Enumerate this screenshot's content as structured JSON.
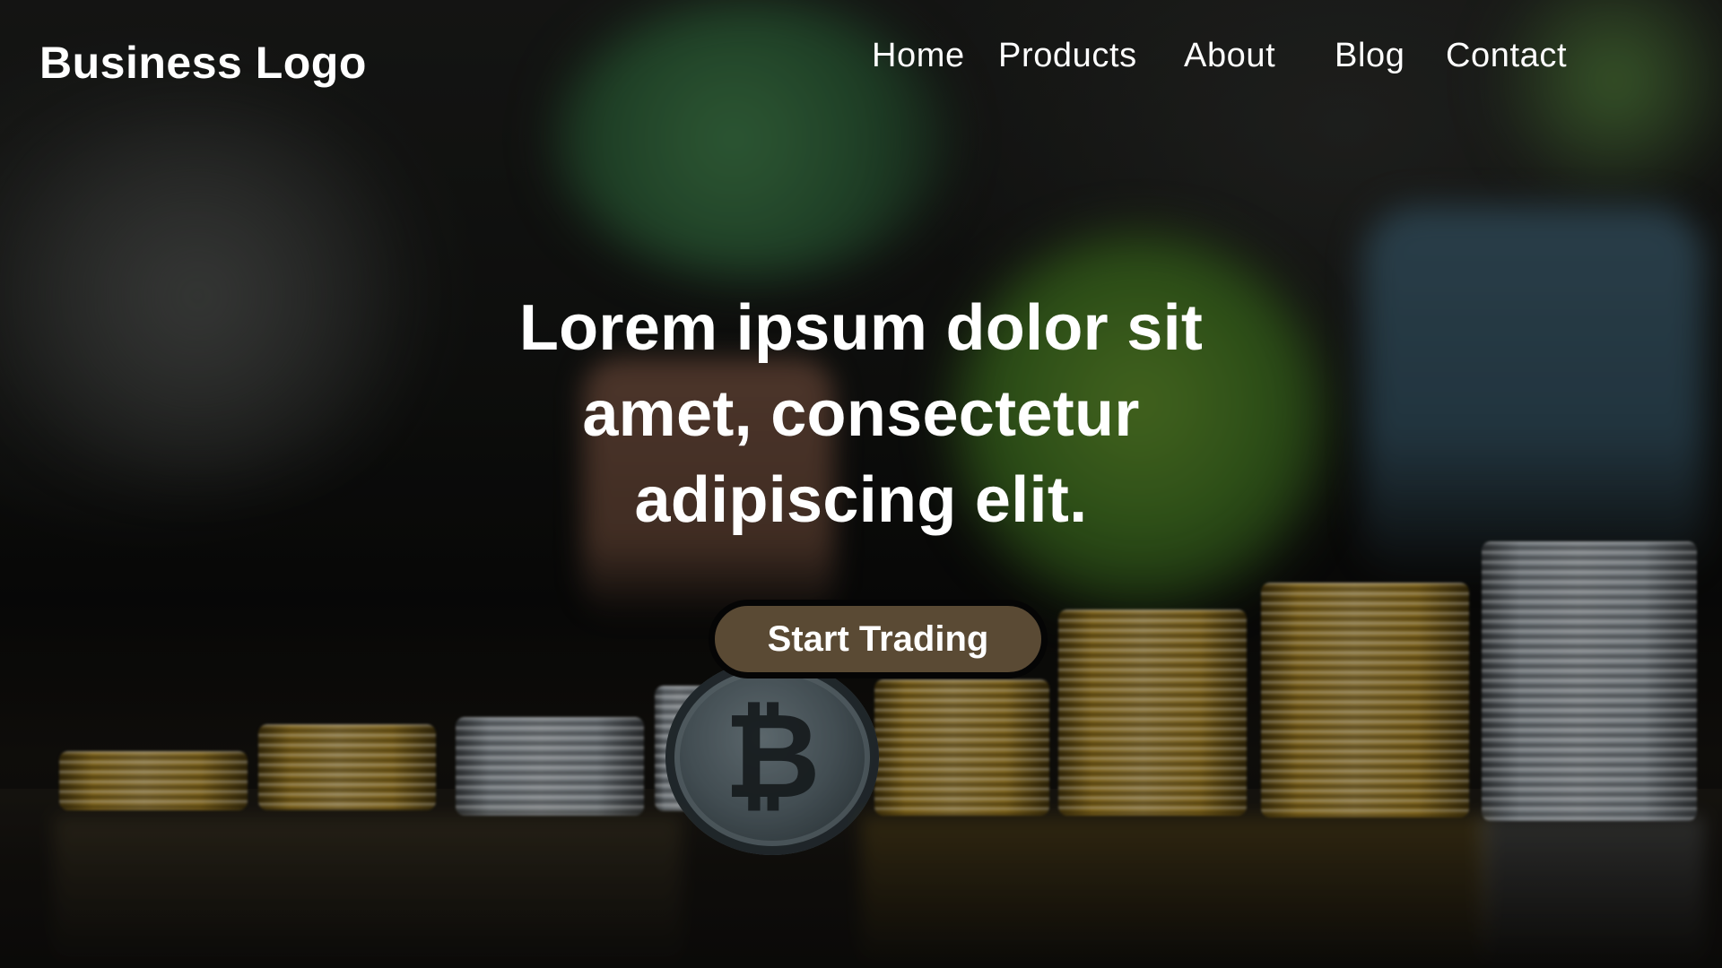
{
  "header": {
    "logo_text": "Business Logo",
    "nav": [
      {
        "label": "Home"
      },
      {
        "label": "Products"
      },
      {
        "label": "About"
      },
      {
        "label": "Blog"
      },
      {
        "label": "Contact"
      }
    ]
  },
  "hero": {
    "title_line1": "Lorem ipsum dolor sit",
    "title_line2": "amet, consectetur",
    "title_line3": "adipiscing elit.",
    "cta_label": "Start Trading",
    "background_description_colors": {
      "cta_fill": "#5a4a34",
      "cta_border": "#050505",
      "text": "#ffffff"
    }
  },
  "background": {
    "coin_icon": "bitcoin-icon"
  }
}
